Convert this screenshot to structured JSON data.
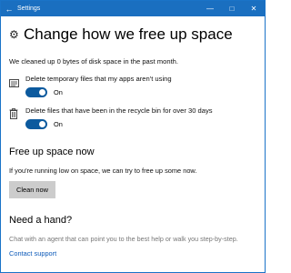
{
  "window": {
    "title": "Settings",
    "controls": {
      "minimize": "—",
      "maximize": "□",
      "close": "✕"
    }
  },
  "page": {
    "title": "Change how we free up space",
    "summary": "We cleaned up 0 bytes of disk space in the past month."
  },
  "options": [
    {
      "label": "Delete temporary files that my apps aren't using",
      "state": "On",
      "icon": "app-list-icon"
    },
    {
      "label": "Delete files that have been in the recycle bin for over 30 days",
      "state": "On",
      "icon": "recycle-bin-icon"
    }
  ],
  "free_up": {
    "heading": "Free up space now",
    "description": "If you're running low on space, we can try to free up some now.",
    "button": "Clean now"
  },
  "help": {
    "heading": "Need a hand?",
    "description": "Chat with an agent that can point you to the best help or walk you step-by-step.",
    "link": "Contact support"
  },
  "colors": {
    "titlebar": "#1a6fc0",
    "toggle_on": "#0c5a9e",
    "link": "#0a58b8"
  }
}
